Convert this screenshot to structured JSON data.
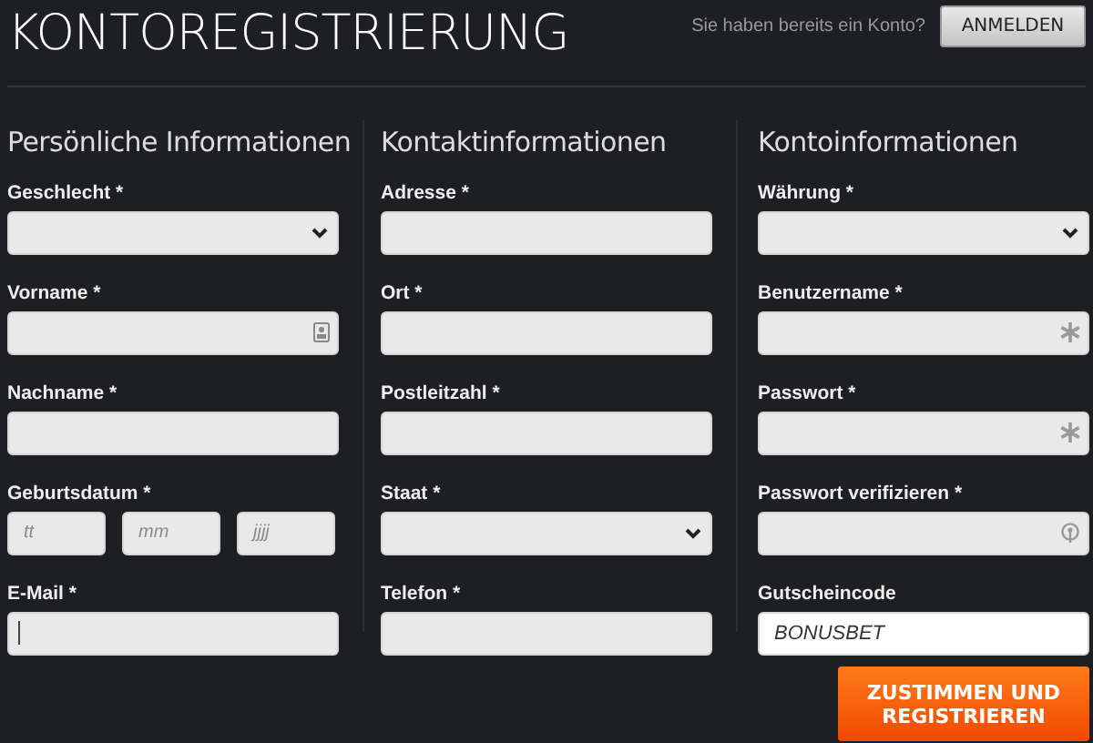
{
  "header": {
    "title": "KONTOREGISTRIERUNG",
    "login_prompt": "Sie haben bereits ein Konto?",
    "login_button": "ANMELDEN"
  },
  "columns": [
    {
      "heading": "Persönliche Informationen",
      "fields": [
        {
          "label": "Geschlecht *",
          "kind": "select"
        },
        {
          "label": "Vorname *",
          "kind": "name"
        },
        {
          "label": "Nachname *",
          "kind": "text"
        },
        {
          "label": "Geburtsdatum *",
          "kind": "date",
          "parts": [
            {
              "placeholder": "tt"
            },
            {
              "placeholder": "mm"
            },
            {
              "placeholder": "jjjj"
            }
          ]
        },
        {
          "label": "E-Mail *",
          "kind": "text",
          "focused": true
        }
      ]
    },
    {
      "heading": "Kontaktinformationen",
      "fields": [
        {
          "label": "Adresse *",
          "kind": "text"
        },
        {
          "label": "Ort *",
          "kind": "text"
        },
        {
          "label": "Postleitzahl *",
          "kind": "text"
        },
        {
          "label": "Staat *",
          "kind": "select"
        },
        {
          "label": "Telefon *",
          "kind": "text"
        }
      ]
    },
    {
      "heading": "Kontoinformationen",
      "fields": [
        {
          "label": "Währung *",
          "kind": "select"
        },
        {
          "label": "Benutzername *",
          "kind": "secret"
        },
        {
          "label": "Passwort *",
          "kind": "secret"
        },
        {
          "label": "Passwort verifizieren *",
          "kind": "verify"
        },
        {
          "label": "Gutscheincode",
          "kind": "text",
          "value": "BONUSBET"
        }
      ]
    }
  ],
  "submit_button": "ZUSTIMMEN UND REGISTRIEREN"
}
